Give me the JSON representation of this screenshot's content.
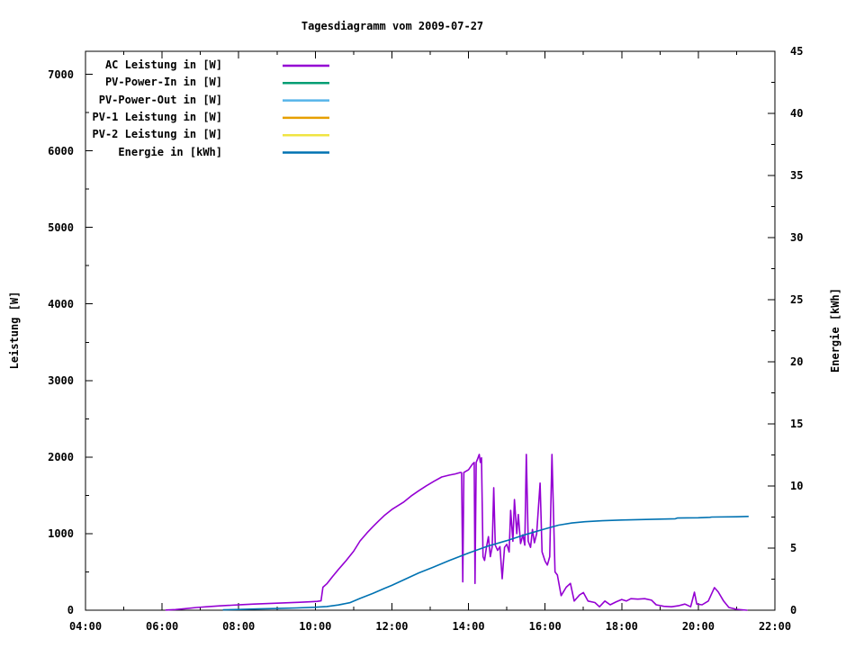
{
  "chart_data": {
    "type": "line",
    "title": "Tagesdiagramm vom 2009-07-27",
    "background": "#ffffff",
    "border_color": "#000000",
    "legend": {
      "position": "top-left-inside"
    },
    "x_axis": {
      "unit": "time",
      "start_hour": 4,
      "end_hour": 22,
      "major_ticks": [
        {
          "hour": 4,
          "label": "04:00"
        },
        {
          "hour": 6,
          "label": "06:00"
        },
        {
          "hour": 8,
          "label": "08:00"
        },
        {
          "hour": 10,
          "label": "10:00"
        },
        {
          "hour": 12,
          "label": "12:00"
        },
        {
          "hour": 14,
          "label": "14:00"
        },
        {
          "hour": 16,
          "label": "16:00"
        },
        {
          "hour": 18,
          "label": "18:00"
        },
        {
          "hour": 20,
          "label": "20:00"
        },
        {
          "hour": 22,
          "label": "22:00"
        }
      ],
      "minor_tick_hours": [
        5,
        7,
        9,
        11,
        13,
        15,
        17,
        19,
        21
      ]
    },
    "y_left": {
      "label": "Leistung [W]",
      "min": 0,
      "max": 7300,
      "major_ticks": [
        {
          "value": 0,
          "label": "0"
        },
        {
          "value": 1000,
          "label": "1000"
        },
        {
          "value": 2000,
          "label": "2000"
        },
        {
          "value": 3000,
          "label": "3000"
        },
        {
          "value": 4000,
          "label": "4000"
        },
        {
          "value": 5000,
          "label": "5000"
        },
        {
          "value": 6000,
          "label": "6000"
        },
        {
          "value": 7000,
          "label": "7000"
        }
      ],
      "minor_tick_values": [
        500,
        1500,
        2500,
        3500,
        4500,
        5500,
        6500
      ]
    },
    "y_right": {
      "label": "Energie [kWh]",
      "min": 0,
      "max": 45,
      "major_ticks": [
        {
          "value": 0,
          "label": "0"
        },
        {
          "value": 5,
          "label": "5"
        },
        {
          "value": 10,
          "label": "10"
        },
        {
          "value": 15,
          "label": "15"
        },
        {
          "value": 20,
          "label": "20"
        },
        {
          "value": 25,
          "label": "25"
        },
        {
          "value": 30,
          "label": "30"
        },
        {
          "value": 35,
          "label": "35"
        },
        {
          "value": 40,
          "label": "40"
        },
        {
          "value": 45,
          "label": "45"
        }
      ],
      "minor_tick_values": [
        2.5,
        7.5,
        12.5,
        17.5,
        22.5,
        27.5,
        32.5,
        37.5,
        42.5
      ]
    },
    "series": [
      {
        "name": "AC Leistung in [W]",
        "color": "#9400d3",
        "axis": "left",
        "visible": true,
        "points": [
          [
            6.1,
            2
          ],
          [
            6.35,
            8
          ],
          [
            6.6,
            20
          ],
          [
            6.9,
            35
          ],
          [
            7.2,
            46
          ],
          [
            7.5,
            56
          ],
          [
            7.8,
            65
          ],
          [
            8.1,
            73
          ],
          [
            8.4,
            80
          ],
          [
            8.7,
            86
          ],
          [
            9.0,
            92
          ],
          [
            9.3,
            98
          ],
          [
            9.6,
            104
          ],
          [
            9.9,
            110
          ],
          [
            10.05,
            115
          ],
          [
            10.15,
            122
          ],
          [
            10.2,
            300
          ],
          [
            10.3,
            345
          ],
          [
            10.45,
            440
          ],
          [
            10.6,
            530
          ],
          [
            10.8,
            645
          ],
          [
            11.0,
            770
          ],
          [
            11.17,
            905
          ],
          [
            11.35,
            1010
          ],
          [
            11.5,
            1090
          ],
          [
            11.65,
            1165
          ],
          [
            11.8,
            1235
          ],
          [
            12.0,
            1315
          ],
          [
            12.3,
            1410
          ],
          [
            12.5,
            1490
          ],
          [
            12.7,
            1560
          ],
          [
            12.9,
            1625
          ],
          [
            13.1,
            1685
          ],
          [
            13.3,
            1740
          ],
          [
            13.5,
            1765
          ],
          [
            13.65,
            1780
          ],
          [
            13.8,
            1800
          ],
          [
            13.82,
            1795
          ],
          [
            13.85,
            370
          ],
          [
            13.88,
            1800
          ],
          [
            14.0,
            1835
          ],
          [
            14.1,
            1905
          ],
          [
            14.15,
            1930
          ],
          [
            14.17,
            350
          ],
          [
            14.2,
            1930
          ],
          [
            14.24,
            1980
          ],
          [
            14.28,
            2035
          ],
          [
            14.31,
            1930
          ],
          [
            14.34,
            1990
          ],
          [
            14.38,
            700
          ],
          [
            14.42,
            650
          ],
          [
            14.47,
            830
          ],
          [
            14.52,
            960
          ],
          [
            14.57,
            700
          ],
          [
            14.62,
            830
          ],
          [
            14.66,
            1600
          ],
          [
            14.7,
            850
          ],
          [
            14.76,
            780
          ],
          [
            14.82,
            830
          ],
          [
            14.88,
            410
          ],
          [
            14.94,
            820
          ],
          [
            15.0,
            860
          ],
          [
            15.06,
            760
          ],
          [
            15.1,
            1305
          ],
          [
            15.16,
            900
          ],
          [
            15.2,
            1445
          ],
          [
            15.26,
            1000
          ],
          [
            15.3,
            1250
          ],
          [
            15.36,
            870
          ],
          [
            15.42,
            985
          ],
          [
            15.47,
            850
          ],
          [
            15.51,
            2035
          ],
          [
            15.56,
            900
          ],
          [
            15.62,
            820
          ],
          [
            15.67,
            1055
          ],
          [
            15.72,
            880
          ],
          [
            15.78,
            1000
          ],
          [
            15.87,
            1660
          ],
          [
            15.92,
            760
          ],
          [
            16.0,
            640
          ],
          [
            16.06,
            590
          ],
          [
            16.12,
            700
          ],
          [
            16.18,
            2035
          ],
          [
            16.26,
            500
          ],
          [
            16.32,
            460
          ],
          [
            16.42,
            190
          ],
          [
            16.55,
            300
          ],
          [
            16.66,
            350
          ],
          [
            16.76,
            120
          ],
          [
            16.9,
            200
          ],
          [
            17.0,
            230
          ],
          [
            17.12,
            120
          ],
          [
            17.3,
            100
          ],
          [
            17.42,
            45
          ],
          [
            17.56,
            120
          ],
          [
            17.7,
            70
          ],
          [
            17.86,
            110
          ],
          [
            18.0,
            140
          ],
          [
            18.12,
            120
          ],
          [
            18.24,
            150
          ],
          [
            18.42,
            145
          ],
          [
            18.6,
            150
          ],
          [
            18.78,
            130
          ],
          [
            18.9,
            70
          ],
          [
            19.1,
            50
          ],
          [
            19.3,
            45
          ],
          [
            19.5,
            60
          ],
          [
            19.65,
            80
          ],
          [
            19.8,
            45
          ],
          [
            19.9,
            235
          ],
          [
            19.96,
            80
          ],
          [
            20.1,
            70
          ],
          [
            20.26,
            120
          ],
          [
            20.42,
            295
          ],
          [
            20.52,
            240
          ],
          [
            20.66,
            120
          ],
          [
            20.8,
            35
          ],
          [
            21.0,
            12
          ],
          [
            21.27,
            0
          ]
        ]
      },
      {
        "name": "PV-Power-In in [W]",
        "color": "#009e73",
        "axis": "left",
        "visible": false,
        "points": []
      },
      {
        "name": "PV-Power-Out in [W]",
        "color": "#56b4e9",
        "axis": "left",
        "visible": false,
        "points": []
      },
      {
        "name": "PV-1 Leistung in [W]",
        "color": "#e69f00",
        "axis": "left",
        "visible": false,
        "points": []
      },
      {
        "name": "PV-2 Leistung in [W]",
        "color": "#f0e442",
        "axis": "left",
        "visible": false,
        "points": []
      },
      {
        "name": "Energie in [kWh]",
        "color": "#0072b2",
        "axis": "right",
        "visible": true,
        "points": [
          [
            7.6,
            0.03
          ],
          [
            8.0,
            0.06
          ],
          [
            8.5,
            0.1
          ],
          [
            9.0,
            0.14
          ],
          [
            9.5,
            0.18
          ],
          [
            10.0,
            0.24
          ],
          [
            10.3,
            0.3
          ],
          [
            10.6,
            0.42
          ],
          [
            10.9,
            0.6
          ],
          [
            11.17,
            0.95
          ],
          [
            11.5,
            1.35
          ],
          [
            11.8,
            1.75
          ],
          [
            12.0,
            2.0
          ],
          [
            12.35,
            2.5
          ],
          [
            12.7,
            3.0
          ],
          [
            13.07,
            3.45
          ],
          [
            13.5,
            4.0
          ],
          [
            14.0,
            4.6
          ],
          [
            14.5,
            5.15
          ],
          [
            15.0,
            5.6
          ],
          [
            15.5,
            6.1
          ],
          [
            16.0,
            6.55
          ],
          [
            16.35,
            6.85
          ],
          [
            16.7,
            7.02
          ],
          [
            17.04,
            7.12
          ],
          [
            17.5,
            7.2
          ],
          [
            18.0,
            7.26
          ],
          [
            18.5,
            7.3
          ],
          [
            19.0,
            7.33
          ],
          [
            19.4,
            7.36
          ],
          [
            19.45,
            7.42
          ],
          [
            20.0,
            7.44
          ],
          [
            20.3,
            7.48
          ],
          [
            20.35,
            7.5
          ],
          [
            21.0,
            7.52
          ],
          [
            21.3,
            7.55
          ]
        ]
      }
    ]
  }
}
